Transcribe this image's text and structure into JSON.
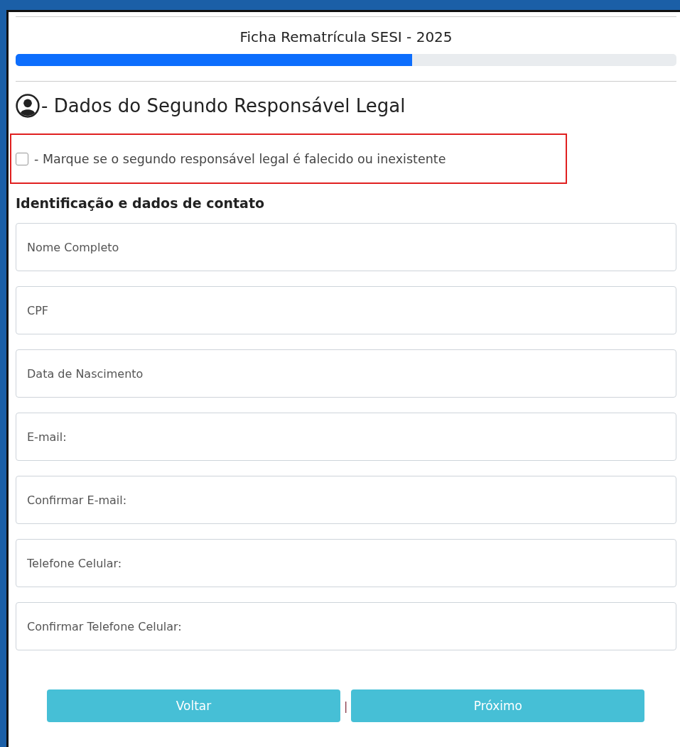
{
  "form": {
    "title": "Ficha Rematrícula SESI - 2025",
    "progress": {
      "level": 0.6
    }
  },
  "section": {
    "title": "- Dados do Segundo Responsável Legal"
  },
  "deceased_option": {
    "label": "- Marque se o segundo responsável legal é falecido ou inexistente",
    "checked": false
  },
  "subsection": {
    "title": "Identificação e dados de contato"
  },
  "fields": [
    {
      "placeholder": "Nome Completo"
    },
    {
      "placeholder": "CPF"
    },
    {
      "placeholder": "Data de Nascimento"
    },
    {
      "placeholder": "E-mail:"
    },
    {
      "placeholder": "Confirmar E-mail:"
    },
    {
      "placeholder": "Telefone Celular:"
    },
    {
      "placeholder": "Confirmar Telefone Celular:"
    }
  ],
  "buttons": {
    "back": "Voltar",
    "separator": "|",
    "next": "Próximo"
  }
}
